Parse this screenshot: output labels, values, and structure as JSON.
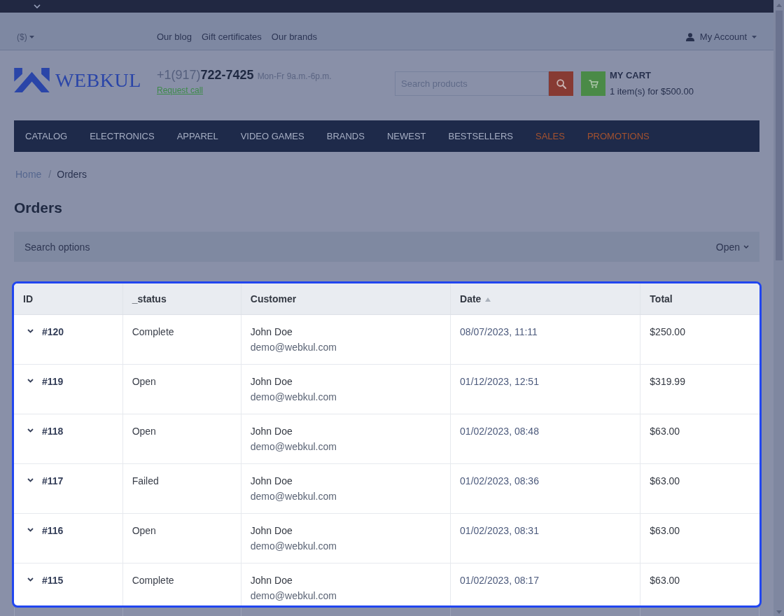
{
  "top_links": {
    "currency": "($)",
    "links": [
      "Our blog",
      "Gift certificates",
      "Our brands"
    ],
    "account": "My Account"
  },
  "header": {
    "logo": "WEBKUL",
    "phone": "+1(917)**722-7425**",
    "hours": "Mon-Fr 9a.m.-6p.m.",
    "request_call": "Request call",
    "search": {
      "placeholder": "Search products"
    },
    "cart": {
      "title": "MY CART",
      "summary": "1 item(s) for $500.00"
    }
  },
  "nav": [
    {
      "label": "CATALOG",
      "color": "#a6aec3"
    },
    {
      "label": "ELECTRONICS",
      "color": "#a6aec3"
    },
    {
      "label": "APPAREL",
      "color": "#a6aec3"
    },
    {
      "label": "VIDEO GAMES",
      "color": "#a6aec3"
    },
    {
      "label": "BRANDS",
      "color": "#a6aec3"
    },
    {
      "label": "NEWEST",
      "color": "#a6aec3"
    },
    {
      "label": "BESTSELLERS",
      "color": "#a6aec3"
    },
    {
      "label": "SALES",
      "color": "#a4522f"
    },
    {
      "label": "PROMOTIONS",
      "color": "#a4522f"
    }
  ],
  "breadcrumb": {
    "items": [
      {
        "label": "Home",
        "current": false
      },
      {
        "label": "Orders",
        "current": true
      }
    ],
    "separator": "/"
  },
  "title": "Orders",
  "search_options": {
    "label": "Search options",
    "toggle": "Open"
  },
  "table": {
    "highlighted": true,
    "columns": [
      {
        "label": "ID",
        "sorted": false
      },
      {
        "label": "_status",
        "sorted": false
      },
      {
        "label": "Customer",
        "sorted": false
      },
      {
        "label": "Date",
        "sorted": true
      },
      {
        "label": "Total",
        "sorted": false
      }
    ],
    "rows": [
      {
        "id": "#120",
        "expanded": false,
        "status": "Complete",
        "customer": "John Doe",
        "email": "demo@webkul.com",
        "date": "08/07/2023, 11:11",
        "total": "$250.00"
      },
      {
        "id": "#119",
        "expanded": false,
        "status": "Open",
        "customer": "John Doe",
        "email": "demo@webkul.com",
        "date": "01/12/2023, 12:51",
        "total": "$319.99"
      },
      {
        "id": "#118",
        "expanded": false,
        "status": "Open",
        "customer": "John Doe",
        "email": "demo@webkul.com",
        "date": "01/02/2023, 08:48",
        "total": "$63.00"
      },
      {
        "id": "#117",
        "expanded": false,
        "status": "Failed",
        "customer": "John Doe",
        "email": "demo@webkul.com",
        "date": "01/02/2023, 08:36",
        "total": "$63.00"
      },
      {
        "id": "#116",
        "expanded": false,
        "status": "Open",
        "customer": "John Doe",
        "email": "demo@webkul.com",
        "date": "01/02/2023, 08:31",
        "total": "$63.00"
      },
      {
        "id": "#115",
        "expanded": false,
        "status": "Complete",
        "customer": "John Doe",
        "email": "demo@webkul.com",
        "date": "01/02/2023, 08:17",
        "total": "$63.00"
      }
    ]
  }
}
